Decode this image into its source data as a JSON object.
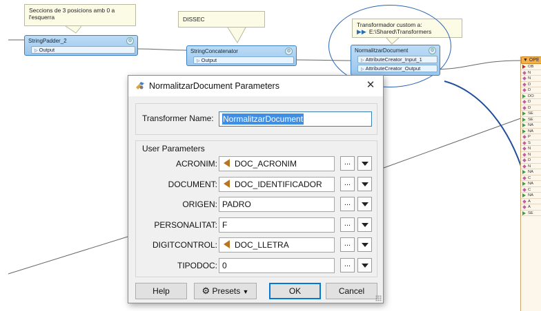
{
  "canvas": {
    "notes": {
      "padder_note": "Seccions de 3 posicions amb 0 a l'esquerra",
      "dissec_note": "DISSEC",
      "custom_note_line1": "Transformador custom a:",
      "custom_note_line2": "E:\\Shared\\Transformers"
    },
    "transformers": {
      "string_padder": {
        "title": "StringPadder_2",
        "port": "Output"
      },
      "string_concatenator": {
        "title": "StringConcatenator",
        "port": "Output"
      },
      "normalitzar": {
        "title": "NormalitzarDocument",
        "input_port": "AttributeCreator_Input_1",
        "output_port": "AttributeCreator_Output"
      }
    },
    "feature_type": {
      "header": "OPE",
      "attributes": [
        {
          "text": "OB",
          "kind": "red"
        },
        {
          "text": "N",
          "kind": "pink"
        },
        {
          "text": "N",
          "kind": "pink"
        },
        {
          "text": "D",
          "kind": "pink"
        },
        {
          "text": "D",
          "kind": "pink"
        },
        {
          "text": "DO",
          "kind": "green"
        },
        {
          "text": "D",
          "kind": "pink"
        },
        {
          "text": "D",
          "kind": "pink"
        },
        {
          "text": "SE",
          "kind": "green"
        },
        {
          "text": "SE",
          "kind": "green"
        },
        {
          "text": "NA",
          "kind": "green"
        },
        {
          "text": "NA",
          "kind": "green"
        },
        {
          "text": "P",
          "kind": "pink"
        },
        {
          "text": "S",
          "kind": "pink"
        },
        {
          "text": "N",
          "kind": "pink"
        },
        {
          "text": "N",
          "kind": "pink"
        },
        {
          "text": "D",
          "kind": "pink"
        },
        {
          "text": "N",
          "kind": "pink"
        },
        {
          "text": "NA",
          "kind": "green"
        },
        {
          "text": "C",
          "kind": "pink"
        },
        {
          "text": "NA",
          "kind": "green"
        },
        {
          "text": "C",
          "kind": "pink"
        },
        {
          "text": "NA",
          "kind": "green"
        },
        {
          "text": "A",
          "kind": "pink"
        },
        {
          "text": "A",
          "kind": "pink"
        },
        {
          "text": "SE",
          "kind": "green"
        }
      ]
    }
  },
  "dialog": {
    "title": "NormalitzarDocument Parameters",
    "transformer_name_label": "Transformer Name:",
    "transformer_name_value": "NormalitzarDocument",
    "user_parameters_label": "User Parameters",
    "params": [
      {
        "label": "ACRONIM:",
        "value": "DOC_ACRONIM",
        "is_attribute": true
      },
      {
        "label": "DOCUMENT:",
        "value": "DOC_IDENTIFICADOR",
        "is_attribute": true
      },
      {
        "label": "ORIGEN:",
        "value": "PADRO",
        "is_attribute": false
      },
      {
        "label": "PERSONALITAT:",
        "value": "F",
        "is_attribute": false
      },
      {
        "label": "DIGITCONTROL:",
        "value": "DOC_LLETRA",
        "is_attribute": true
      },
      {
        "label": "TIPODOC:",
        "value": "0",
        "is_attribute": false
      }
    ],
    "ellipsis_label": "...",
    "buttons": {
      "help": "Help",
      "presets": "Presets",
      "ok": "OK",
      "cancel": "Cancel"
    }
  },
  "colors": {
    "transformer_fill": "#9cc6ec",
    "selection_ring": "#2a63b4",
    "attribute_icon": "#b8741f",
    "text_selection": "#3d8ee4"
  }
}
